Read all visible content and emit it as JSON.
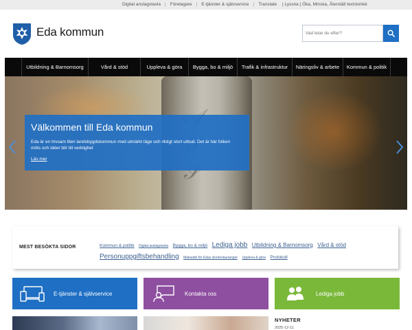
{
  "topbar": {
    "links": [
      "Digital anslagstavla",
      "Företagare",
      "E-tjänster & självservice",
      "Translate"
    ],
    "tools": "| Lyssna | Öka,  Minska,  Återställ textstorlek"
  },
  "header": {
    "site_name": "Eda kommun",
    "search_placeholder": "Vad letar du efter?"
  },
  "nav": {
    "items": [
      "Utbildning & Barnomsorg",
      "Vård & stöd",
      "Uppleva & göra",
      "Bygga, bo & miljö",
      "Trafik & infrastruktur",
      "Näringsliv & arbete",
      "Kommun & politik"
    ]
  },
  "hero": {
    "title": "Välkommen till Eda kommun",
    "text": "Eda är en trivsam liten landsbygdskommun med utmärkt läge och riktigt stort utbud. Det är här folken möts och idéer blir till verklighet",
    "link": "Läs mer"
  },
  "most_visited": {
    "label": "MEST BESÖKTA SIDOR",
    "tags": [
      {
        "text": "Kommun & politik",
        "size": "m"
      },
      {
        "text": "Digital anslagstavla",
        "size": "s"
      },
      {
        "text": "Bygga, bo & miljö",
        "size": "m"
      },
      {
        "text": "Lediga jobb",
        "size": "xl"
      },
      {
        "text": "Utbildning & Barnomsorg",
        "size": "l"
      },
      {
        "text": "Vård & stöd",
        "size": "l"
      },
      {
        "text": "Personuppgiftsbehandling",
        "size": "xl"
      },
      {
        "text": "Matsedel för Edas skolrestauranger",
        "size": "s"
      },
      {
        "text": "Uppleva & göra",
        "size": "s"
      },
      {
        "text": "Protokoll",
        "size": "m"
      }
    ]
  },
  "tiles": [
    {
      "label": "E-tjänster & självservice",
      "color": "#1f6fc4"
    },
    {
      "label": "Kontakta oss",
      "color": "#8e4fa0"
    },
    {
      "label": "Lediga jobb",
      "color": "#7ab83a"
    }
  ],
  "news": {
    "label": "NYHETER",
    "date": "2025-12-11"
  }
}
